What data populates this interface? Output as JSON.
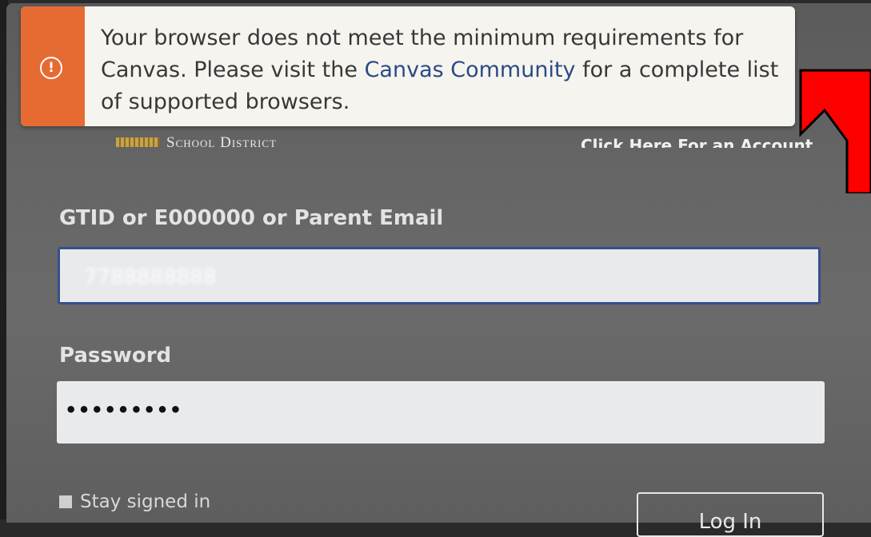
{
  "banner": {
    "line_before_link": "Your browser does not meet the minimum requirements for Canvas. Please visit the ",
    "link_text": "Canvas Community",
    "line_after_link": " for a complete list of supported browsers.",
    "icon": "alert-circle-icon",
    "accent_color": "#e66b33"
  },
  "header": {
    "district_label": "School District",
    "account_link": "Click Here For an Account"
  },
  "form": {
    "username_label": "GTID or E000000 or Parent Email",
    "username_value": "7788888888",
    "password_label": "Password",
    "password_value": "•••••••••",
    "stay_signed_in": "Stay signed in",
    "login_button": "Log In"
  },
  "annotation": {
    "arrow_color": "#ff0000"
  }
}
